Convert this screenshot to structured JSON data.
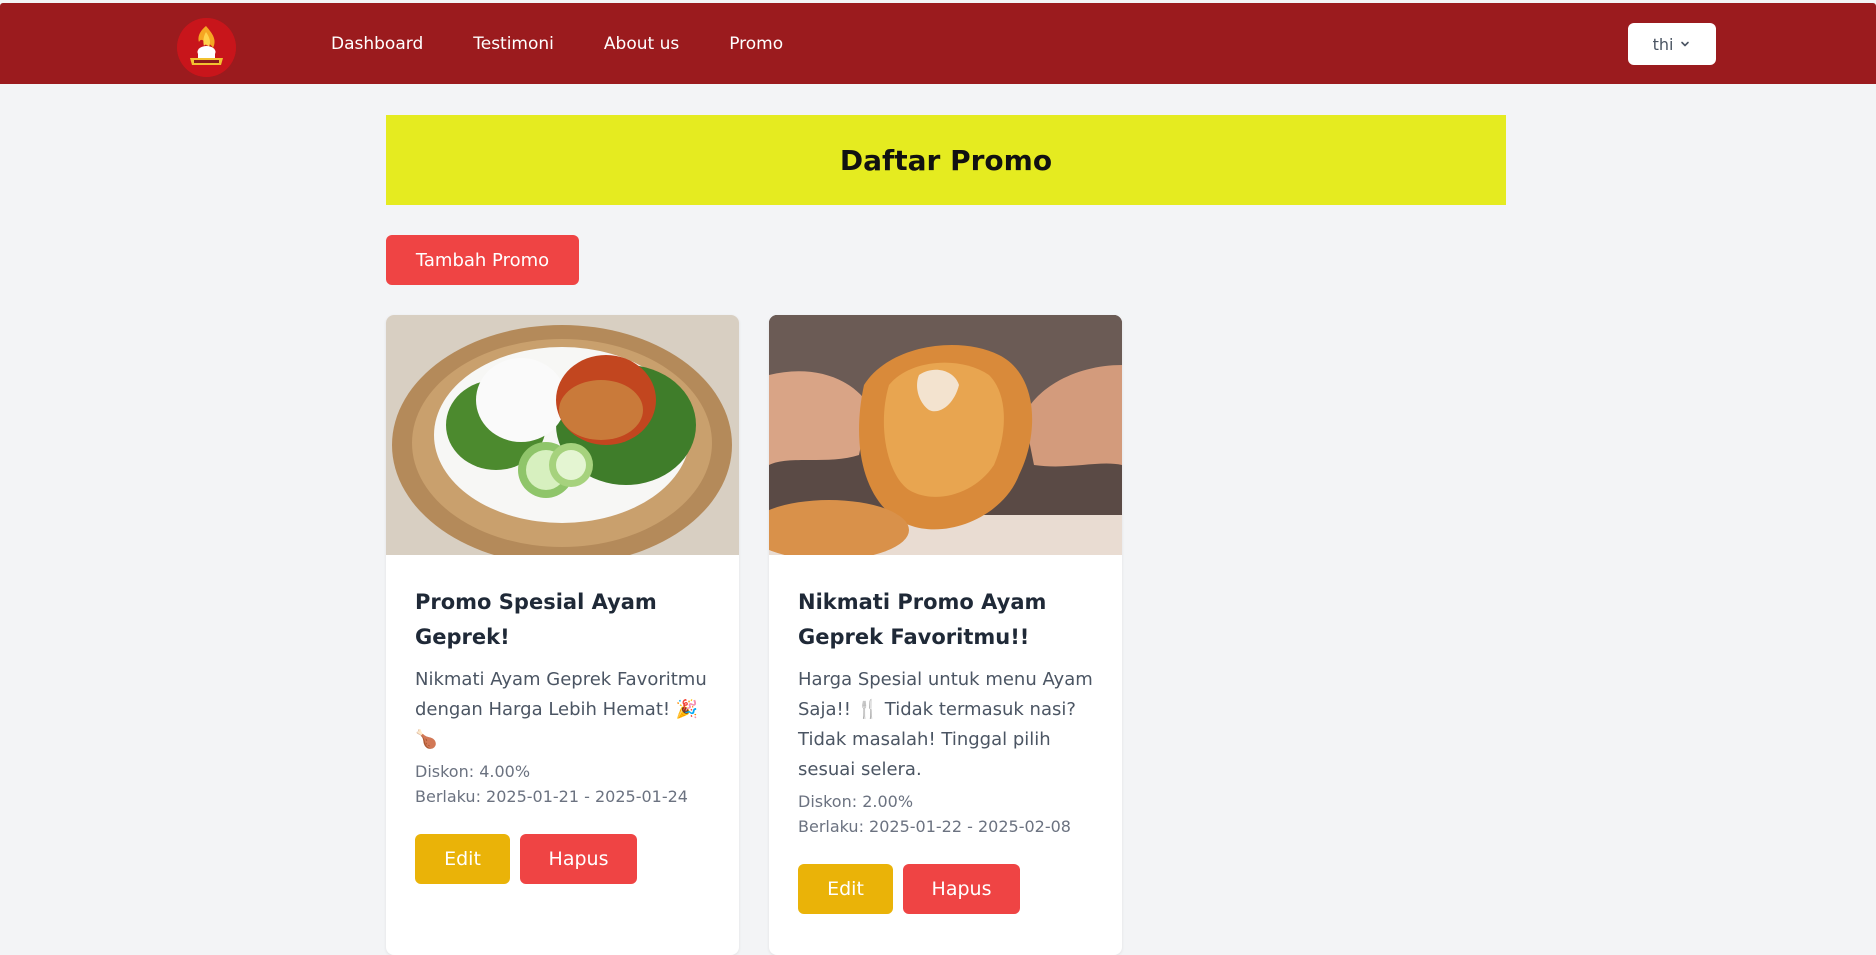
{
  "nav": {
    "links": [
      "Dashboard",
      "Testimoni",
      "About us",
      "Promo"
    ],
    "user": "thi",
    "user_menu_icon": "chevron-down-icon"
  },
  "page": {
    "title": "Daftar Promo",
    "add_button": "Tambah Promo"
  },
  "colors": {
    "navbar": "#9b1b1e",
    "banner": "#e5eb20",
    "primary_red": "#ef4444",
    "edit_yellow": "#eab308",
    "background": "#f3f4f6"
  },
  "promos": [
    {
      "title": "Promo Spesial Ayam Geprek!",
      "description": "Nikmati Ayam Geprek Favoritmu dengan Harga Lebih Hemat! 🎉🍗",
      "discount": "Diskon: 4.00%",
      "period": "Berlaku: 2025-01-21 - 2025-01-24",
      "edit_label": "Edit",
      "delete_label": "Hapus"
    },
    {
      "title": "Nikmati Promo Ayam Geprek Favoritmu!!",
      "description": "Harga Spesial untuk menu Ayam Saja!! 🍴 Tidak termasuk nasi? Tidak masalah! Tinggal pilih sesuai selera.",
      "discount": "Diskon: 2.00%",
      "period": "Berlaku: 2025-01-22 - 2025-02-08",
      "edit_label": "Edit",
      "delete_label": "Hapus"
    }
  ]
}
